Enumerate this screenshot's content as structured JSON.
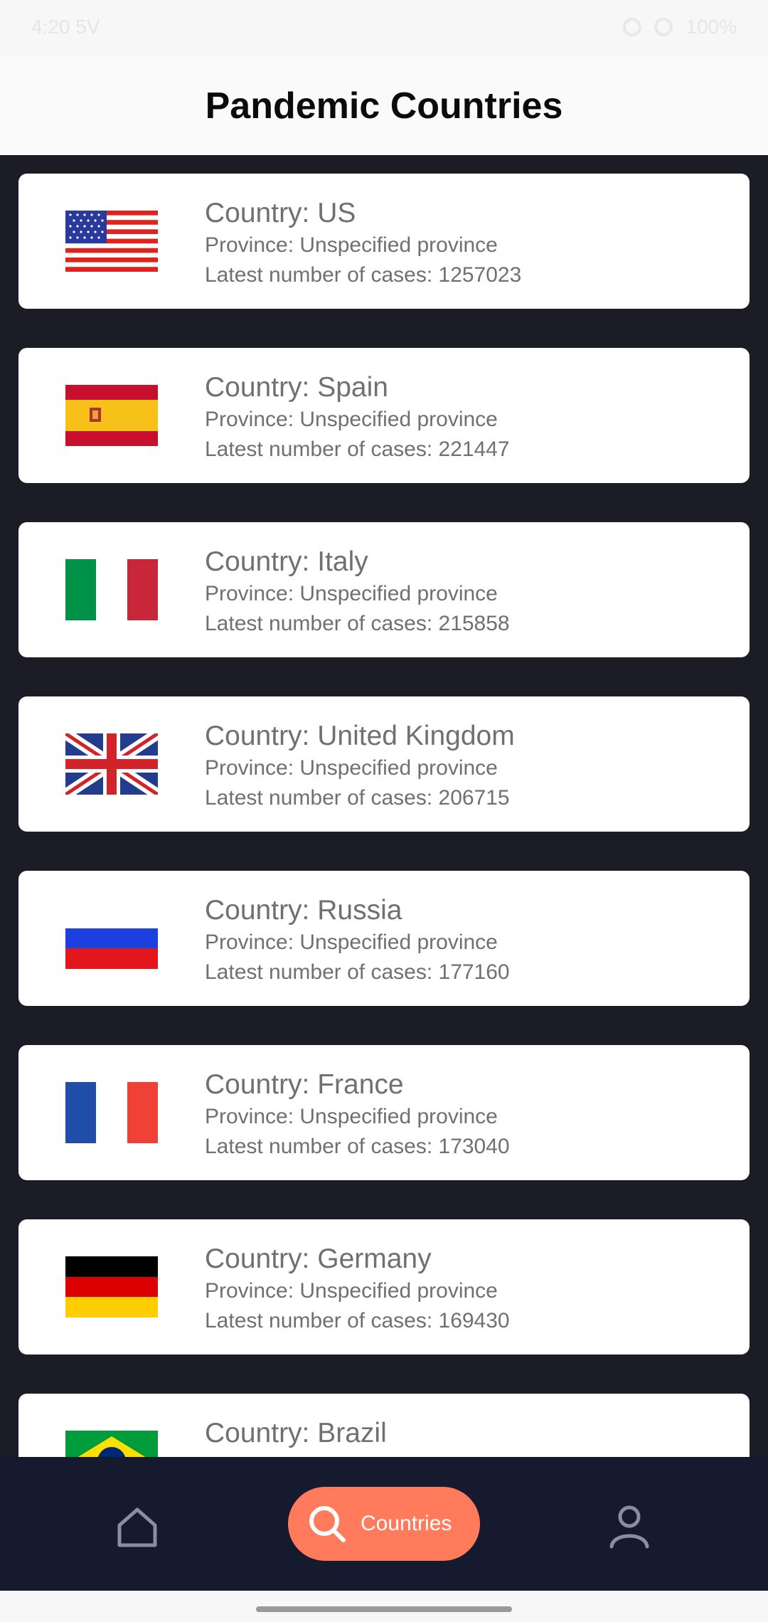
{
  "status_bar": {
    "time": "4:20 5V",
    "battery": "100%"
  },
  "header": {
    "title": "Pandemic Countries"
  },
  "countries": [
    {
      "country": "Country: US",
      "province": "Province: Unspecified province",
      "cases": "Latest number of cases: 1257023",
      "flag": "us-flag-icon"
    },
    {
      "country": "Country: Spain",
      "province": "Province: Unspecified province",
      "cases": "Latest number of cases: 221447",
      "flag": "spain-flag-icon"
    },
    {
      "country": "Country: Italy",
      "province": "Province: Unspecified province",
      "cases": "Latest number of cases: 215858",
      "flag": "italy-flag-icon"
    },
    {
      "country": "Country: United Kingdom",
      "province": "Province: Unspecified province",
      "cases": "Latest number of cases: 206715",
      "flag": "uk-flag-icon"
    },
    {
      "country": "Country: Russia",
      "province": "Province: Unspecified province",
      "cases": "Latest number of cases: 177160",
      "flag": "russia-flag-icon"
    },
    {
      "country": "Country: France",
      "province": "Province: Unspecified province",
      "cases": "Latest number of cases: 173040",
      "flag": "france-flag-icon"
    },
    {
      "country": "Country: Germany",
      "province": "Province: Unspecified province",
      "cases": "Latest number of cases: 169430",
      "flag": "germany-flag-icon"
    },
    {
      "country": "Country: Brazil",
      "province": "",
      "cases": "",
      "flag": "brazil-flag-icon"
    }
  ],
  "bottom_nav": {
    "home_icon": "home-icon",
    "active_label": "Countries",
    "active_icon": "search-icon",
    "profile_icon": "profile-icon",
    "active_color": "#ff7b5c",
    "background_color": "#151a2e"
  }
}
